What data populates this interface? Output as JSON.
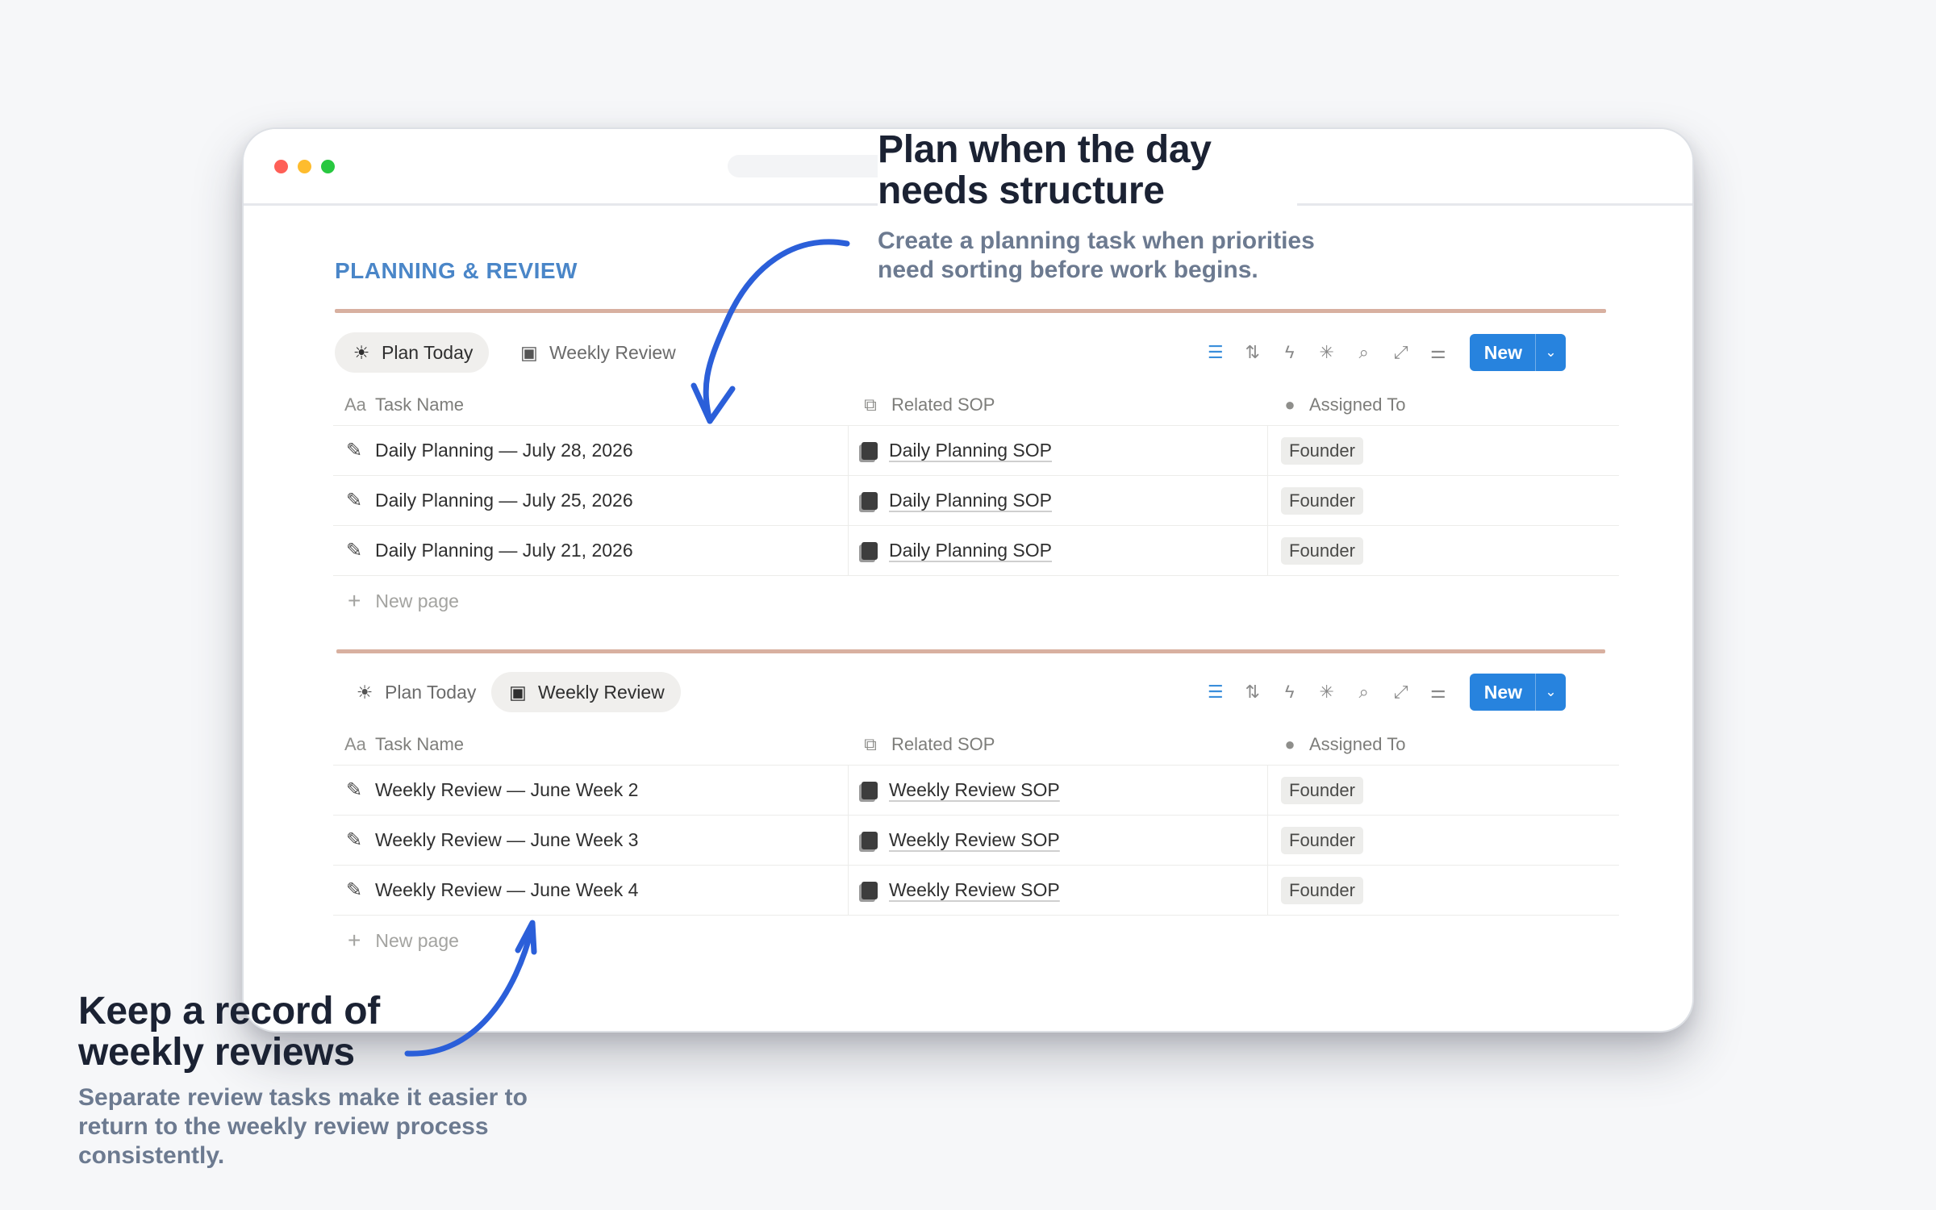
{
  "window": {
    "traffic_lights": [
      "#fe5f57",
      "#febc2e",
      "#28c840"
    ]
  },
  "page": {
    "title": "PLANNING & REVIEW"
  },
  "databases": [
    {
      "tabs": [
        {
          "label": "Plan Today",
          "icon": "sun-icon",
          "active": true
        },
        {
          "label": "Weekly Review",
          "icon": "calendar-icon",
          "active": false
        }
      ],
      "toolbar": {
        "icons": [
          "filter-icon",
          "sort-icon",
          "lightning-icon",
          "sparkle-icon",
          "search-icon",
          "expand-icon",
          "settings-icon"
        ],
        "new_label": "New"
      },
      "columns": [
        "Task Name",
        "Related SOP",
        "Assigned To"
      ],
      "rows": [
        {
          "task": "Daily Planning — July 28, 2026",
          "sop": "Daily Planning SOP",
          "assignee": "Founder"
        },
        {
          "task": "Daily Planning — July 25, 2026",
          "sop": "Daily Planning SOP",
          "assignee": "Founder"
        },
        {
          "task": "Daily Planning — July 21, 2026",
          "sop": "Daily Planning SOP",
          "assignee": "Founder"
        }
      ],
      "new_page_label": "New page"
    },
    {
      "tabs": [
        {
          "label": "Plan Today",
          "icon": "sun-icon",
          "active": false
        },
        {
          "label": "Weekly Review",
          "icon": "calendar-icon",
          "active": true
        }
      ],
      "toolbar": {
        "icons": [
          "filter-icon",
          "sort-icon",
          "lightning-icon",
          "sparkle-icon",
          "search-icon",
          "expand-icon",
          "settings-icon"
        ],
        "new_label": "New"
      },
      "columns": [
        "Task Name",
        "Related SOP",
        "Assigned To"
      ],
      "rows": [
        {
          "task": "Weekly Review — June Week 2",
          "sop": "Weekly Review SOP",
          "assignee": "Founder"
        },
        {
          "task": "Weekly Review — June Week 3",
          "sop": "Weekly Review SOP",
          "assignee": "Founder"
        },
        {
          "task": "Weekly Review — June Week 4",
          "sop": "Weekly Review SOP",
          "assignee": "Founder"
        }
      ],
      "new_page_label": "New page"
    }
  ],
  "annotations": {
    "top": {
      "title": "Plan when the day needs structure",
      "subtitle": "Create a planning task when priorities need sorting before work begins."
    },
    "bottom": {
      "title": "Keep a record of weekly reviews",
      "subtitle": "Separate review tasks make it easier to return to the weekly review process consistently."
    },
    "arrow_color": "#2b5fd9"
  },
  "colors": {
    "accent_blue": "#2783de",
    "title_blue": "#4a86c8",
    "divider": "#d8b0a0"
  }
}
